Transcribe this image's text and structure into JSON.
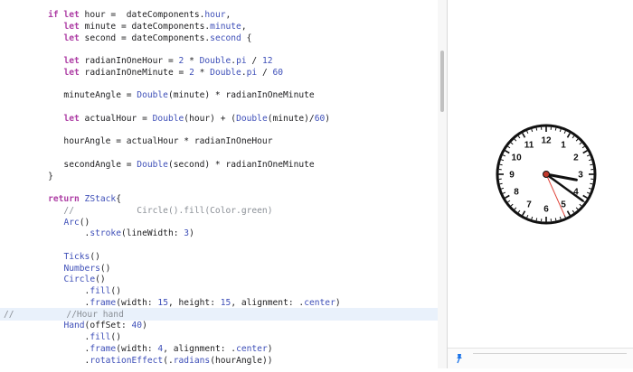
{
  "editor": {
    "lines": [
      [
        {
          "t": "    "
        },
        {
          "t": "if let",
          "c": "kw"
        },
        {
          "t": " hour =  dateComponents."
        },
        {
          "t": "hour",
          "c": "ty"
        },
        {
          "t": ","
        }
      ],
      [
        {
          "t": "       "
        },
        {
          "t": "let",
          "c": "kw"
        },
        {
          "t": " minute = dateComponents."
        },
        {
          "t": "minute",
          "c": "ty"
        },
        {
          "t": ","
        }
      ],
      [
        {
          "t": "       "
        },
        {
          "t": "let",
          "c": "kw"
        },
        {
          "t": " second = dateComponents."
        },
        {
          "t": "second",
          "c": "ty"
        },
        {
          "t": " {"
        }
      ],
      [],
      [
        {
          "t": "       "
        },
        {
          "t": "let",
          "c": "kw"
        },
        {
          "t": " radianInOneHour = "
        },
        {
          "t": "2",
          "c": "nm"
        },
        {
          "t": " * "
        },
        {
          "t": "Double",
          "c": "ty"
        },
        {
          "t": "."
        },
        {
          "t": "pi",
          "c": "ty"
        },
        {
          "t": " / "
        },
        {
          "t": "12",
          "c": "nm"
        }
      ],
      [
        {
          "t": "       "
        },
        {
          "t": "let",
          "c": "kw"
        },
        {
          "t": " radianInOneMinute = "
        },
        {
          "t": "2",
          "c": "nm"
        },
        {
          "t": " * "
        },
        {
          "t": "Double",
          "c": "ty"
        },
        {
          "t": "."
        },
        {
          "t": "pi",
          "c": "ty"
        },
        {
          "t": " / "
        },
        {
          "t": "60",
          "c": "nm"
        }
      ],
      [],
      [
        {
          "t": "       minuteAngle = "
        },
        {
          "t": "Double",
          "c": "ty"
        },
        {
          "t": "(minute) * radianInOneMinute"
        }
      ],
      [],
      [
        {
          "t": "       "
        },
        {
          "t": "let",
          "c": "kw"
        },
        {
          "t": " actualHour = "
        },
        {
          "t": "Double",
          "c": "ty"
        },
        {
          "t": "(hour) + ("
        },
        {
          "t": "Double",
          "c": "ty"
        },
        {
          "t": "(minute)/"
        },
        {
          "t": "60",
          "c": "nm"
        },
        {
          "t": ")"
        }
      ],
      [],
      [
        {
          "t": "       hourAngle = actualHour * radianInOneHour"
        }
      ],
      [],
      [
        {
          "t": "       secondAngle = "
        },
        {
          "t": "Double",
          "c": "ty"
        },
        {
          "t": "(second) * radianInOneMinute"
        }
      ],
      [
        {
          "t": "    }"
        }
      ],
      [],
      [
        {
          "t": "    "
        },
        {
          "t": "return",
          "c": "kw"
        },
        {
          "t": " "
        },
        {
          "t": "ZStack",
          "c": "ty"
        },
        {
          "t": "{"
        }
      ],
      [
        {
          "t": "       //            Circle().fill(Color.green)",
          "c": "cm"
        }
      ],
      [
        {
          "t": "       "
        },
        {
          "t": "Arc",
          "c": "ty"
        },
        {
          "t": "()"
        }
      ],
      [
        {
          "t": "           ."
        },
        {
          "t": "stroke",
          "c": "ty"
        },
        {
          "t": "(lineWidth: "
        },
        {
          "t": "3",
          "c": "nm"
        },
        {
          "t": ")"
        }
      ],
      [],
      [
        {
          "t": "       "
        },
        {
          "t": "Ticks",
          "c": "ty"
        },
        {
          "t": "()"
        }
      ],
      [
        {
          "t": "       "
        },
        {
          "t": "Numbers",
          "c": "ty"
        },
        {
          "t": "()"
        }
      ],
      [
        {
          "t": "       "
        },
        {
          "t": "Circle",
          "c": "ty"
        },
        {
          "t": "()"
        }
      ],
      [
        {
          "t": "           ."
        },
        {
          "t": "fill",
          "c": "ty"
        },
        {
          "t": "()"
        }
      ],
      [
        {
          "t": "           ."
        },
        {
          "t": "frame",
          "c": "ty"
        },
        {
          "t": "(width: "
        },
        {
          "t": "15",
          "c": "nm"
        },
        {
          "t": ", height: "
        },
        {
          "t": "15",
          "c": "nm"
        },
        {
          "t": ", alignment: ."
        },
        {
          "t": "center",
          "c": "ty"
        },
        {
          "t": ")"
        }
      ],
      [
        {
          "t": "//",
          "c": "cm"
        },
        {
          "t": "          //Hour hand",
          "c": "cm"
        }
      ],
      [
        {
          "t": "       "
        },
        {
          "t": "Hand",
          "c": "ty"
        },
        {
          "t": "(offSet: "
        },
        {
          "t": "40",
          "c": "nm"
        },
        {
          "t": ")"
        }
      ],
      [
        {
          "t": "           ."
        },
        {
          "t": "fill",
          "c": "ty"
        },
        {
          "t": "()"
        }
      ],
      [
        {
          "t": "           ."
        },
        {
          "t": "frame",
          "c": "ty"
        },
        {
          "t": "(width: "
        },
        {
          "t": "4",
          "c": "nm"
        },
        {
          "t": ", alignment: ."
        },
        {
          "t": "center",
          "c": "ty"
        },
        {
          "t": ")"
        }
      ],
      [
        {
          "t": "           ."
        },
        {
          "t": "rotationEffect",
          "c": "ty"
        },
        {
          "t": "(."
        },
        {
          "t": "radians",
          "c": "ty"
        },
        {
          "t": "(hourAngle))"
        }
      ]
    ],
    "highlighted_line": 26
  },
  "clock": {
    "numbers": [
      "12",
      "1",
      "2",
      "3",
      "4",
      "5",
      "6",
      "7",
      "8",
      "9",
      "10",
      "11"
    ],
    "time": {
      "hour": 3,
      "minute": 21,
      "second": 26
    },
    "colors": {
      "face": "#ffffff",
      "rim": "#111111",
      "hands": "#111111",
      "second_hand": "#e0463c",
      "center": "#c0392b"
    }
  },
  "preview": {
    "pin_icon": "pin-icon"
  }
}
